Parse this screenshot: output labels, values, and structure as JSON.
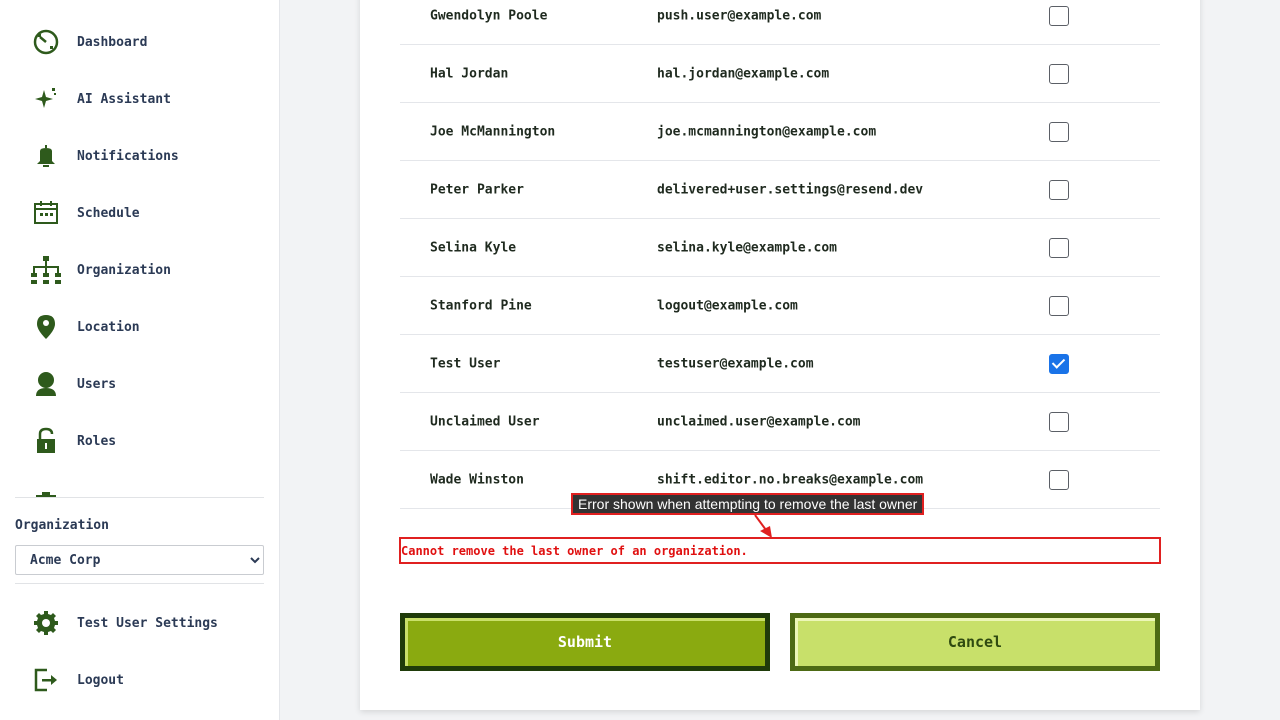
{
  "sidebar": {
    "nav": [
      {
        "label": "Dashboard",
        "icon": "dashboard-icon"
      },
      {
        "label": "AI Assistant",
        "icon": "sparkle-icon"
      },
      {
        "label": "Notifications",
        "icon": "bell-icon"
      },
      {
        "label": "Schedule",
        "icon": "calendar-icon"
      },
      {
        "label": "Organization",
        "icon": "org-chart-icon"
      },
      {
        "label": "Location",
        "icon": "map-pin-icon"
      },
      {
        "label": "Users",
        "icon": "user-icon"
      },
      {
        "label": "Roles",
        "icon": "lock-icon"
      }
    ],
    "org_label": "Organization",
    "org_selected": "Acme Corp",
    "settings_label": "Test User Settings",
    "logout_label": "Logout"
  },
  "users": [
    {
      "name": "Gwendolyn Poole",
      "email": "push.user@example.com",
      "checked": false
    },
    {
      "name": "Hal Jordan",
      "email": "hal.jordan@example.com",
      "checked": false
    },
    {
      "name": "Joe McMannington",
      "email": "joe.mcmannington@example.com",
      "checked": false
    },
    {
      "name": "Peter Parker",
      "email": "delivered+user.settings@resend.dev",
      "checked": false
    },
    {
      "name": "Selina Kyle",
      "email": "selina.kyle@example.com",
      "checked": false
    },
    {
      "name": "Stanford Pine",
      "email": "logout@example.com",
      "checked": false
    },
    {
      "name": "Test User",
      "email": "testuser@example.com",
      "checked": true
    },
    {
      "name": "Unclaimed User",
      "email": "unclaimed.user@example.com",
      "checked": false
    },
    {
      "name": "Wade Winston",
      "email": "shift.editor.no.breaks@example.com",
      "checked": false
    }
  ],
  "annotation": "Error shown when attempting to remove the last owner",
  "error_message": "Cannot remove the last owner of an organization.",
  "buttons": {
    "submit": "Submit",
    "cancel": "Cancel"
  },
  "colors": {
    "accent": "#8aaa10",
    "icon": "#2e5a1c",
    "error": "#e01010",
    "checkbox": "#1a73e8"
  }
}
